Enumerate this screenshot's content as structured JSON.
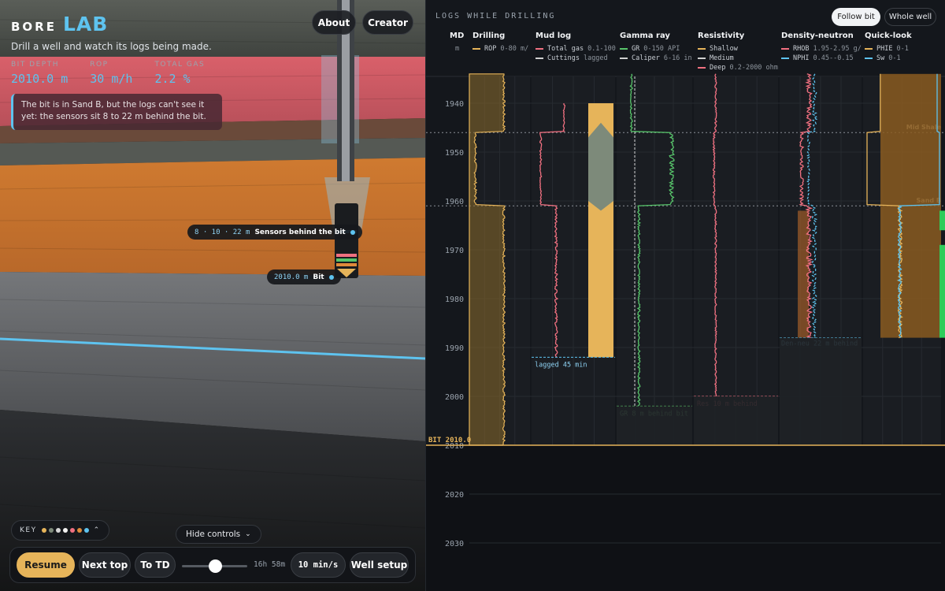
{
  "app": {
    "brand_word1": "BORE",
    "brand_word2": "LAB",
    "tagline": "Drill a well and watch its logs being made.",
    "about_label": "About",
    "creator_label": "Creator"
  },
  "stats": [
    {
      "label": "BIT DEPTH",
      "value": "2010.0 m"
    },
    {
      "label": "ROP",
      "value": "30 m/h"
    },
    {
      "label": "TOTAL GAS",
      "value": "2.2 %"
    }
  ],
  "callout": "The bit is in Sand B, but the logs can't see it yet: the sensors sit 8 to 22 m behind the bit.",
  "scene_tags": {
    "sensors_values": "8 · 10 · 22 m",
    "sensors_label": "Sensors behind the bit",
    "bit_value": "2010.0 m",
    "bit_label": "Bit"
  },
  "key": {
    "label": "KEY",
    "swatches": [
      "#e6b45a",
      "#7d8a7a",
      "#d8d8d8",
      "#f2f2f2",
      "#f07080",
      "#e08a3a",
      "#5ec3ef"
    ]
  },
  "hide_controls": "Hide controls",
  "controls": {
    "resume": "Resume",
    "next_top": "Next top",
    "to_td": "To TD",
    "slider_fraction": 0.5,
    "eta": "16h 58m",
    "speed": "10 min/s",
    "well_setup": "Well setup"
  },
  "logs": {
    "title": "LOGS WHILE DRILLING",
    "follow_bit": "Follow bit",
    "whole_well": "Whole well",
    "md_header": "MD",
    "md_unit": "m",
    "tracks": [
      {
        "name": "Drilling",
        "entries": [
          {
            "label": "ROP",
            "range": "0-80 m/",
            "color": "#e6b45a",
            "dash": false
          }
        ]
      },
      {
        "name": "Mud log",
        "entries": [
          {
            "label": "Total gas",
            "range": "0.1-100",
            "color": "#f07080",
            "dash": false
          },
          {
            "label": "Cuttings",
            "range": "lagged",
            "color": "#d0d0d0",
            "dash": false
          }
        ]
      },
      {
        "name": "Gamma ray",
        "entries": [
          {
            "label": "GR",
            "range": "0-150 API",
            "color": "#57c46a",
            "dash": false
          },
          {
            "label": "Caliper",
            "range": "6-16 in",
            "color": "#d0d0d0",
            "dash": true
          }
        ]
      },
      {
        "name": "Resistivity",
        "entries": [
          {
            "label": "Shallow",
            "range": "",
            "color": "#e6b45a",
            "dash": false
          },
          {
            "label": "Medium",
            "range": "",
            "color": "#d0d0d0",
            "dash": false
          },
          {
            "label": "Deep",
            "range": "0.2-2000 ohm",
            "color": "#f07080",
            "dash": false
          }
        ]
      },
      {
        "name": "Density-neutron",
        "entries": [
          {
            "label": "RHOB",
            "range": "1.95-2.95 g/",
            "color": "#f07080",
            "dash": false
          },
          {
            "label": "NPHI",
            "range": "0.45--0.15",
            "color": "#5ec3ef",
            "dash": true
          }
        ]
      },
      {
        "name": "Quick-look",
        "entries": [
          {
            "label": "PHIE",
            "range": "0-1",
            "color": "#e6b45a",
            "dash": false
          },
          {
            "label": "Sw",
            "range": "0-1",
            "color": "#5ec3ef",
            "dash": false
          }
        ]
      }
    ],
    "depth_ticks": [
      1940,
      1950,
      1960,
      1970,
      1980,
      1990,
      2000,
      2010,
      2020,
      2030
    ],
    "bit_label": "BIT 2010.0",
    "bit_depth": 2010.0,
    "tops": [
      {
        "name": "Mid Shale",
        "depth": 1946
      },
      {
        "name": "Sand B",
        "depth": 1961
      }
    ],
    "lag_labels": {
      "mud": "lagged 45 min",
      "gr": "GR 8 m behind bit",
      "res": "Res 10 m behind",
      "dn": "Den-neu 22 m behind"
    },
    "logged_to": {
      "mud": 1992,
      "gr": 2002,
      "res": 2000,
      "dn": 1988,
      "ql": 1988
    }
  },
  "colors": {
    "accent": "#5ec3ef",
    "gold": "#e6b45a",
    "red": "#f07080",
    "green": "#57c46a"
  }
}
